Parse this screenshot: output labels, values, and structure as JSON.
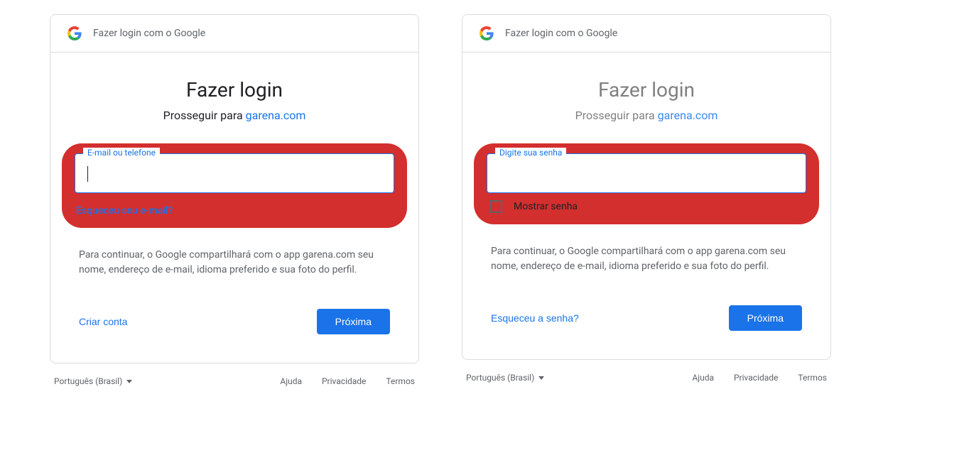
{
  "header": {
    "text": "Fazer login com o Google"
  },
  "title": "Fazer login",
  "subtitle_prefix": "Prosseguir para ",
  "subtitle_link": "garena.com",
  "left": {
    "input_label": "E-mail ou telefone",
    "forgot": "Esqueceu seu e-mail?",
    "secondary_action": "Criar conta"
  },
  "right": {
    "input_label": "Digite sua senha",
    "show_password": "Mostrar senha",
    "secondary_action": "Esqueceu a senha?"
  },
  "info_text": "Para continuar, o Google compartilhará com o app garena.com seu nome, endereço de e-mail, idioma preferido e sua foto do perfil.",
  "primary_button": "Próxima",
  "footer": {
    "language": "Português (Brasil)",
    "links": [
      "Ajuda",
      "Privacidade",
      "Termos"
    ]
  }
}
